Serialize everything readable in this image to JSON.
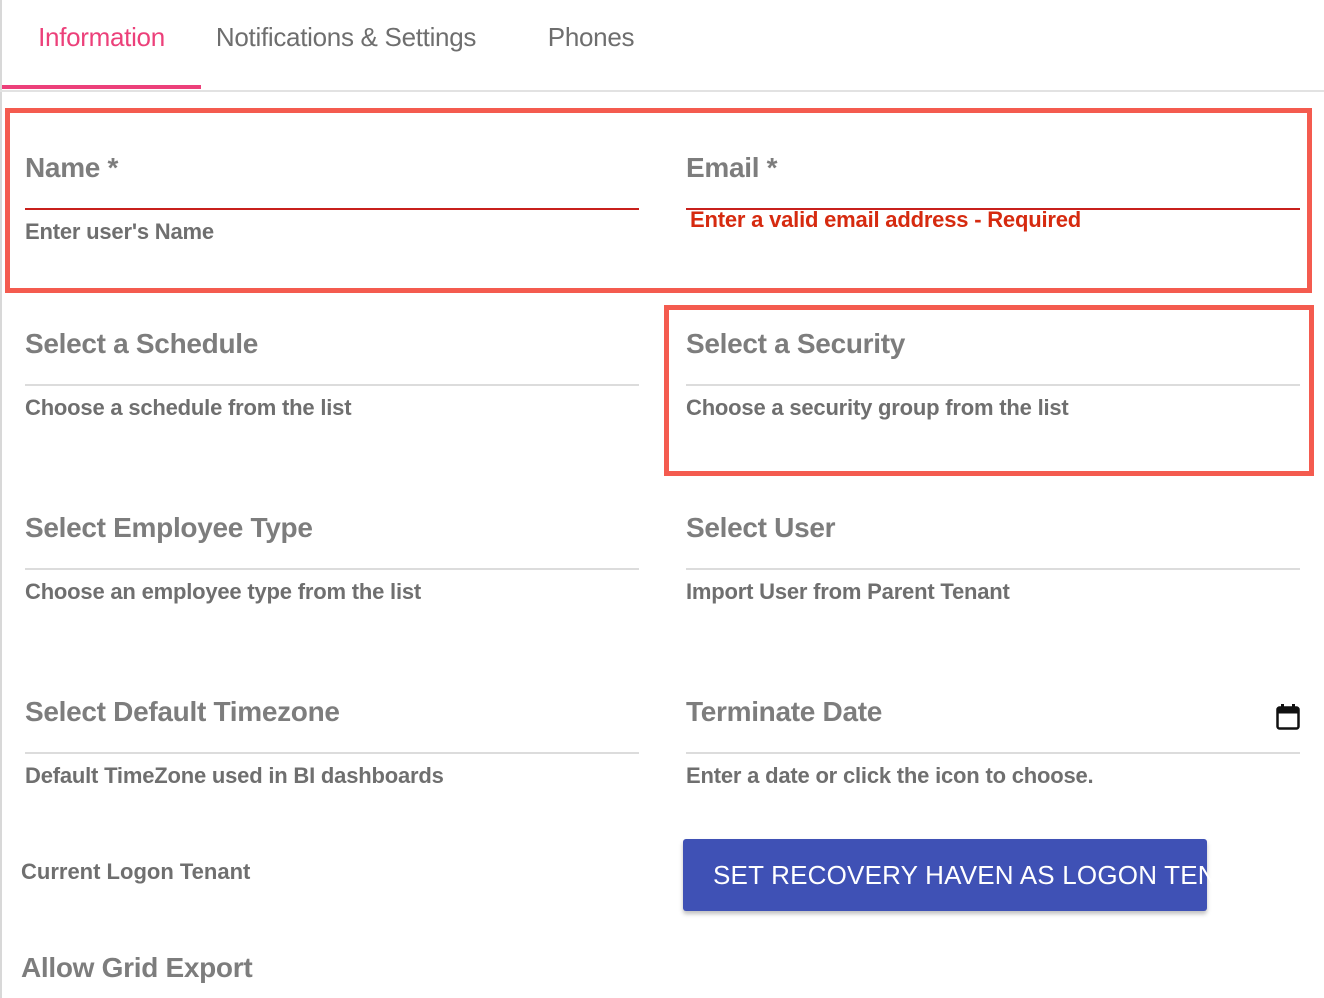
{
  "tabs": [
    {
      "label": "Information",
      "active": true
    },
    {
      "label": "Notifications & Settings",
      "active": false
    },
    {
      "label": "Phones",
      "active": false
    }
  ],
  "form": {
    "name": {
      "label": "Name *",
      "hint": "Enter user's Name",
      "value": ""
    },
    "email": {
      "label": "Email *",
      "hint": "Enter a valid email address - Required",
      "value": ""
    },
    "schedule": {
      "label": "Select a Schedule",
      "hint": "Choose a schedule from the list"
    },
    "security": {
      "label": "Select a Security",
      "hint": "Choose a security group from the list"
    },
    "employee_type": {
      "label": "Select Employee Type",
      "hint": "Choose an employee type from the list"
    },
    "user": {
      "label": "Select User",
      "hint": "Import User from Parent Tenant"
    },
    "timezone": {
      "label": "Select Default Timezone",
      "hint": "Default TimeZone used in BI dashboards"
    },
    "terminate_date": {
      "label": "Terminate Date",
      "hint": "Enter a date or click the icon to choose.",
      "icon": "calendar-icon"
    },
    "current_logon_tenant_label": "Current Logon Tenant",
    "set_logon_button": {
      "label": "SET RECOVERY HAVEN AS LOGON TENANT",
      "icon": "wrench-icon"
    },
    "allow_grid_export_label": "Allow Grid Export"
  },
  "colors": {
    "accent": "#ec407a",
    "error": "#d62a0f",
    "primary_button": "#3f51b5",
    "highlight_box": "#f45b4f"
  }
}
